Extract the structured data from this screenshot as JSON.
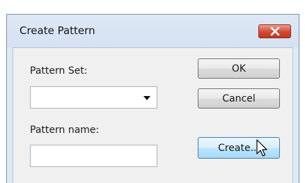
{
  "dialog": {
    "title": "Create Pattern",
    "close_icon": "close-icon"
  },
  "fields": {
    "pattern_set_label": "Pattern Set:",
    "pattern_set_value": "",
    "pattern_name_label": "Pattern name:",
    "pattern_name_value": ""
  },
  "buttons": {
    "ok": "OK",
    "cancel": "Cancel",
    "create": "Create..."
  },
  "icons": {
    "dropdown": "chevron-down-icon",
    "cursor": "mouse-pointer-icon"
  },
  "colors": {
    "close_button": "#d04b32",
    "hover_button_border": "#3c7fb1"
  }
}
